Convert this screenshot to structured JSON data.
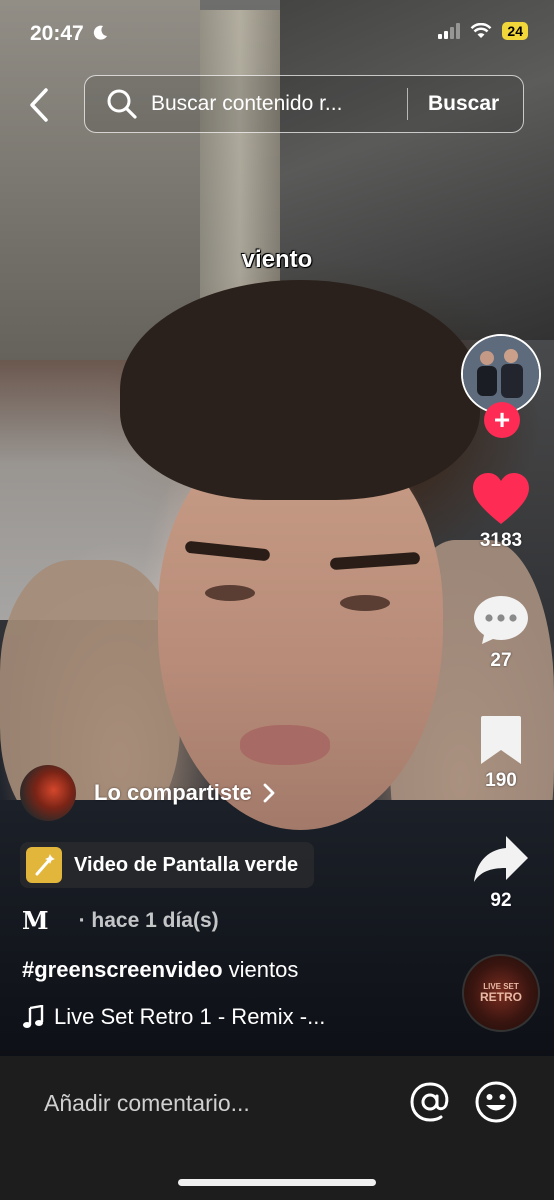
{
  "status_bar": {
    "time": "20:47",
    "battery": "24"
  },
  "search": {
    "placeholder": "Buscar contenido r...",
    "button": "Buscar"
  },
  "video": {
    "caption_overlay": "viento"
  },
  "rail": {
    "likes": "3183",
    "comments": "27",
    "saves": "190",
    "shares": "92",
    "like_color": "#fe2c55",
    "follow_color": "#fe2c55"
  },
  "info": {
    "shared_label": "Lo compartiste",
    "effect_label": "Video de Pantalla verde",
    "author_logo": "M",
    "posted": "· hace 1 día(s)",
    "hashtag": "#greenscreenvideo",
    "description_rest": " vientos",
    "music": "Live Set Retro 1 - Remix -...",
    "disc_label_1": "LIVE SET",
    "disc_label_2": "RETRO"
  },
  "comment_bar": {
    "placeholder": "Añadir comentario..."
  },
  "icons": [
    "moon-icon",
    "signal-icon",
    "wifi-icon",
    "back-icon",
    "search-icon",
    "heart-icon",
    "comment-icon",
    "bookmark-icon",
    "share-icon",
    "music-note-icon",
    "at-icon",
    "emoji-icon",
    "sparkle-icon"
  ]
}
